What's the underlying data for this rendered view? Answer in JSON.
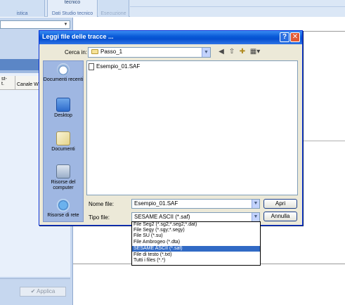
{
  "ribbon": {
    "group1_label": "istica",
    "group2_top": "tecnico",
    "group2_label": "Dati Studio tecnico",
    "group3_label": "Esecuzione"
  },
  "left_pane": {
    "grid_header_1": "st-\nt.",
    "grid_header_2": "Canale W",
    "apply_label": "✔ Applica"
  },
  "dialog": {
    "title": "Leggi file delle tracce ...",
    "look_in_label": "Cerca in:",
    "look_in_value": "Passo_1",
    "places": [
      "Documenti recenti",
      "Desktop",
      "Documenti",
      "Risorse del computer",
      "Risorse di rete"
    ],
    "files": [
      "Esempio_01.SAF"
    ],
    "file_name_label": "Nome file:",
    "file_name_value": "Esempio_01.SAF",
    "file_type_label": "Tipo file:",
    "file_type_value": "SESAME ASCII (*.saf)",
    "open_label": "Apri",
    "cancel_label": "Annulla",
    "type_options": [
      "File Seg2 (*.sg2;*.seg2;*.dat)",
      "File Segy (*.sgy;*.segy)",
      "File SU (*.su)",
      "File Ambrogeo (*.dta)",
      "SESAME ASCII (*.saf)",
      "File di testo (*.txt)",
      "Tutti i files (*.*)"
    ],
    "selected_option_index": 4
  },
  "colors": {
    "title_bar": "#0a5bd8",
    "selection": "#316ac5",
    "dialog_face": "#ece9d8"
  }
}
